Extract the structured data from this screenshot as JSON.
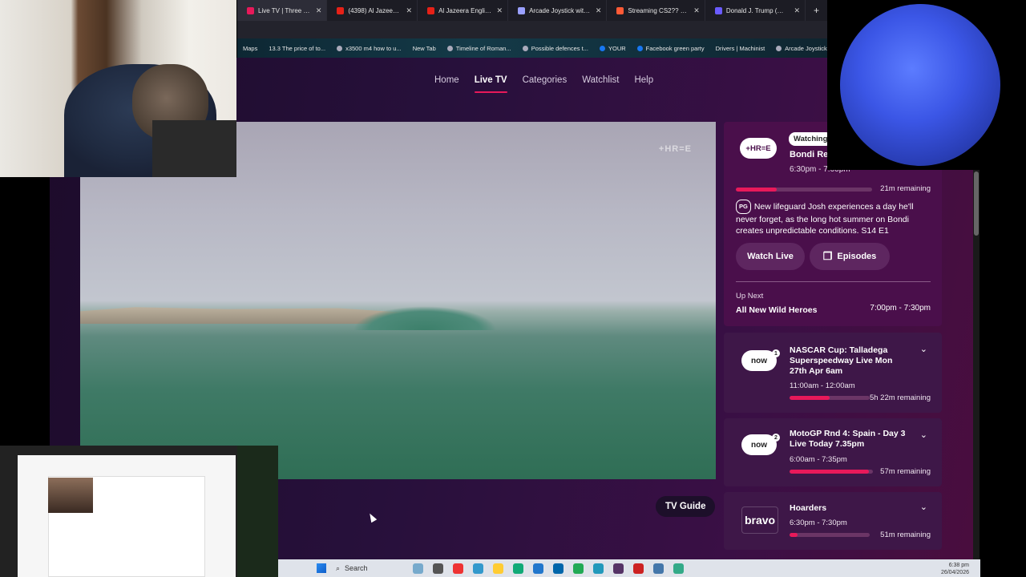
{
  "browser": {
    "tabs": [
      {
        "label": "Live TV | Three | Th",
        "color": "#e8195a",
        "active": true
      },
      {
        "label": "(4398) Al Jazeera E",
        "color": "#e62117"
      },
      {
        "label": "Al Jazeera English |",
        "color": "#e62117"
      },
      {
        "label": "Arcade Joystick with M",
        "color": "#9aa0ff"
      },
      {
        "label": "Streaming CS2?? - No",
        "color": "#ff5a36"
      },
      {
        "label": "Donald J. Trump (@rea",
        "color": "#6a5bff"
      }
    ],
    "new_tab": "+",
    "bookmarks": [
      "Maps",
      "13.3 The price of to...",
      "x3500 m4 how to u...",
      "New Tab",
      "Timeline of Roman...",
      "Possible defences t...",
      "YOUR",
      "Facebook green party",
      "Drivers | Machinist",
      "Arcade Joystick w"
    ]
  },
  "nav": {
    "items": [
      "Home",
      "Live TV",
      "Categories",
      "Watchlist",
      "Help"
    ]
  },
  "video": {
    "watermark": "+HR=E"
  },
  "current": {
    "channel_logo": "+HR=E",
    "badge": "Watching",
    "title": "Bondi Res",
    "time": "6:30pm - 7:00pm",
    "progress": 0.3,
    "remaining": "21m remaining",
    "rating": "PG",
    "description": "New lifeguard Josh experiences a day he'll never forget, as the long hot summer on Bondi creates unpredictable conditions. S14 E1",
    "watch_live": "Watch Live",
    "episodes": "Episodes",
    "upnext_label": "Up Next",
    "upnext_title": "All New Wild Heroes",
    "upnext_time": "7:00pm - 7:30pm"
  },
  "cards": [
    {
      "logo": "now",
      "num": "1",
      "title": "NASCAR Cup: Talladega Superspeedway Live Mon 27th Apr 6am",
      "time": "11:00am - 12:00am",
      "progress": 0.5,
      "remaining": "5h 22m remaining"
    },
    {
      "logo": "now",
      "num": "2",
      "title": "MotoGP Rnd 4: Spain - Day 3 Live Today 7.35pm",
      "time": "6:00am - 7:35pm",
      "progress": 0.95,
      "remaining": "57m remaining"
    },
    {
      "logo": "bravo",
      "num": "",
      "title": "Hoarders",
      "time": "6:30pm - 7:30pm",
      "progress": 0.1,
      "remaining": "51m remaining"
    }
  ],
  "tv_guide": "TV Guide",
  "taskbar": {
    "search": "Search",
    "time": "6:38 pm",
    "date": "26/04/2026"
  }
}
